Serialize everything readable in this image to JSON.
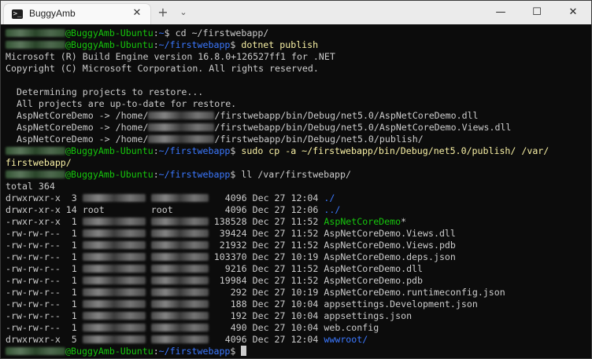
{
  "window": {
    "tab_title": "BuggyAmb",
    "tab_icon": "terminal-icon",
    "new_tab": "+",
    "dropdown": "⌄",
    "close_tab": "✕",
    "minimize": "—",
    "maximize": "☐",
    "close": "✕"
  },
  "colors": {
    "background": "#0c0c0c",
    "text": "#cccccc",
    "prompt_user": "#16c60c",
    "prompt_path": "#3b78ff",
    "command": "#f9f1a5",
    "executable": "#16c60c",
    "directory": "#3b78ff"
  },
  "terminal": {
    "prompt_host": "@BuggyAmb-Ubuntu",
    "prompt_sep": ":",
    "home_path": "~",
    "app_path": "~/firstwebapp",
    "prompt_end": "$ ",
    "cmd1": "cd ~/firstwebapp/",
    "cmd2": "dotnet publish",
    "out_msbuild": "Microsoft (R) Build Engine version 16.8.0+126527ff1 for .NET",
    "out_copyright": "Copyright (C) Microsoft Corporation. All rights reserved.",
    "out_determining": "  Determining projects to restore...",
    "out_uptodate": "  All projects are up-to-date for restore.",
    "out_dll_prefix": "  AspNetCoreDemo -> /home/",
    "out_dll_suffix": "/firstwebapp/bin/Debug/net5.0/AspNetCoreDemo.dll",
    "out_views_prefix": "  AspNetCoreDemo -> /home/",
    "out_views_suffix": "/firstwebapp/bin/Debug/net5.0/AspNetCoreDemo.Views.dll",
    "out_publish_prefix": "  AspNetCoreDemo -> /home/",
    "out_publish_suffix": "/firstwebapp/bin/Debug/net5.0/publish/",
    "cmd3": "sudo cp -a ~/firstwebapp/bin/Debug/net5.0/publish/ /var/",
    "cmd3_wrap": "firstwebapp/",
    "cmd4": "ll /var/firstwebapp/",
    "total": "total 364",
    "listing": [
      {
        "perm": "drwxrwxr-x",
        "links": "  3",
        "owner": "",
        "group": "",
        "size": "  4096",
        "date": "Dec 27 12:04",
        "name": "./",
        "kind": "dir"
      },
      {
        "perm": "drwxr-xr-x",
        "links": " 14",
        "owner": "root",
        "group": "root",
        "size": "  4096",
        "date": "Dec 27 12:06",
        "name": "../",
        "kind": "dir"
      },
      {
        "perm": "-rwxr-xr-x",
        "links": "  1",
        "owner": "",
        "group": "",
        "size": "138528",
        "date": "Dec 27 11:52",
        "name": "AspNetCoreDemo",
        "suffix": "*",
        "kind": "exec"
      },
      {
        "perm": "-rw-rw-r--",
        "links": "  1",
        "owner": "",
        "group": "",
        "size": " 39424",
        "date": "Dec 27 11:52",
        "name": "AspNetCoreDemo.Views.dll",
        "kind": "file"
      },
      {
        "perm": "-rw-rw-r--",
        "links": "  1",
        "owner": "",
        "group": "",
        "size": " 21932",
        "date": "Dec 27 11:52",
        "name": "AspNetCoreDemo.Views.pdb",
        "kind": "file"
      },
      {
        "perm": "-rw-rw-r--",
        "links": "  1",
        "owner": "",
        "group": "",
        "size": "103370",
        "date": "Dec 27 10:19",
        "name": "AspNetCoreDemo.deps.json",
        "kind": "file"
      },
      {
        "perm": "-rw-rw-r--",
        "links": "  1",
        "owner": "",
        "group": "",
        "size": "  9216",
        "date": "Dec 27 11:52",
        "name": "AspNetCoreDemo.dll",
        "kind": "file"
      },
      {
        "perm": "-rw-rw-r--",
        "links": "  1",
        "owner": "",
        "group": "",
        "size": " 19984",
        "date": "Dec 27 11:52",
        "name": "AspNetCoreDemo.pdb",
        "kind": "file"
      },
      {
        "perm": "-rw-rw-r--",
        "links": "  1",
        "owner": "",
        "group": "",
        "size": "   292",
        "date": "Dec 27 10:19",
        "name": "AspNetCoreDemo.runtimeconfig.json",
        "kind": "file"
      },
      {
        "perm": "-rw-rw-r--",
        "links": "  1",
        "owner": "",
        "group": "",
        "size": "   188",
        "date": "Dec 27 10:04",
        "name": "appsettings.Development.json",
        "kind": "file"
      },
      {
        "perm": "-rw-rw-r--",
        "links": "  1",
        "owner": "",
        "group": "",
        "size": "   192",
        "date": "Dec 27 10:04",
        "name": "appsettings.json",
        "kind": "file"
      },
      {
        "perm": "-rw-rw-r--",
        "links": "  1",
        "owner": "",
        "group": "",
        "size": "   490",
        "date": "Dec 27 10:04",
        "name": "web.config",
        "kind": "file"
      },
      {
        "perm": "drwxrwxr-x",
        "links": "  5",
        "owner": "",
        "group": "",
        "size": "  4096",
        "date": "Dec 27 12:04",
        "name": "wwwroot",
        "suffix": "/",
        "kind": "dir"
      }
    ]
  }
}
